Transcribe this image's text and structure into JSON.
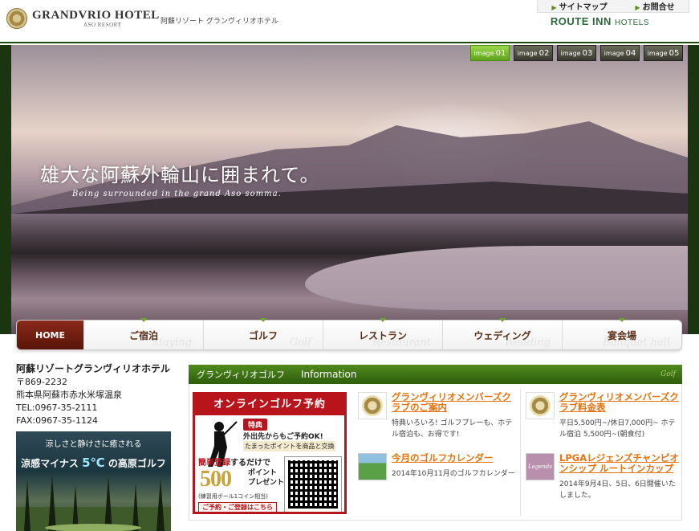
{
  "header": {
    "logo_main": "GRANDVRIO HOTEL",
    "logo_sub": "ASO RESORT",
    "tagline": "阿蘇リゾート グランヴィリオホテル",
    "util_links": [
      "サイトマップ",
      "お問合せ"
    ],
    "route_inn_main": "ROUTE INN",
    "route_inn_sub": "HOTELS"
  },
  "hero": {
    "title": "雄大な阿蘇外輪山に囲まれて。",
    "subtitle": "Being surrounded in the grand Aso somma.",
    "image_tab_prefix": "image",
    "image_tabs": [
      "01",
      "02",
      "03",
      "04",
      "05"
    ],
    "active_tab": 0
  },
  "nav": {
    "items": [
      {
        "label": "HOME",
        "en": ""
      },
      {
        "label": "ご宿泊",
        "en": "Staying"
      },
      {
        "label": "ゴルフ",
        "en": "Golf"
      },
      {
        "label": "レストラン",
        "en": "Restaurant"
      },
      {
        "label": "ウェディング",
        "en": "Wedding"
      },
      {
        "label": "宴会場",
        "en": "Banquet hall"
      }
    ]
  },
  "address": {
    "hotel_name": "阿蘇リゾートグランヴィリオホテル",
    "postal": "〒869-2232",
    "street": "熊本県阿蘇市赤水米塚温泉",
    "tel": "TEL:0967-35-2111",
    "fax": "FAX:0967-35-1124"
  },
  "golf_banner": {
    "top": "涼しさと静けさに癒される",
    "main_pre": "涼感マイナス",
    "temp": "5℃",
    "main_post": "の高原ゴルフ"
  },
  "info": {
    "section": "グランヴィリオゴルフ",
    "label": "Information",
    "golf_en": "Golf"
  },
  "promo": {
    "head": "オンラインゴルフ予約",
    "badge": "特典",
    "line1": "外出先からもご予約OK!",
    "line2": "たまったポイントを商品と交換",
    "reg_hl": "簡単登録",
    "reg_rest": "するだけで",
    "amount": "500",
    "points": "ポイント",
    "present": "プレゼント",
    "note": "(練習用ボール1コイン相当)",
    "button": "ご予約・ご登録はこちら"
  },
  "news": {
    "col1": [
      {
        "title": "グランヴィリオメンバーズクラブのご案内",
        "desc": "特典いろいろ! ゴルフプレーも、ホテル宿泊も、お得です!"
      },
      {
        "title": "今月のゴルフカレンダー",
        "desc": "2014年10月11月のゴルフカレンダー"
      }
    ],
    "col2": [
      {
        "title": "グランヴィリオメンバーズクラブ料金表",
        "desc": "平日5,500円~/休日7,000円~ ホテル宿泊 5,500円~(朝食付)"
      },
      {
        "title": "LPGAレジェンズチャンピオンシップ ルートインカップ",
        "desc": "2014年9月4日、5日、6日開催いたしました。"
      }
    ]
  },
  "lpga_thumb_text": "Legends"
}
